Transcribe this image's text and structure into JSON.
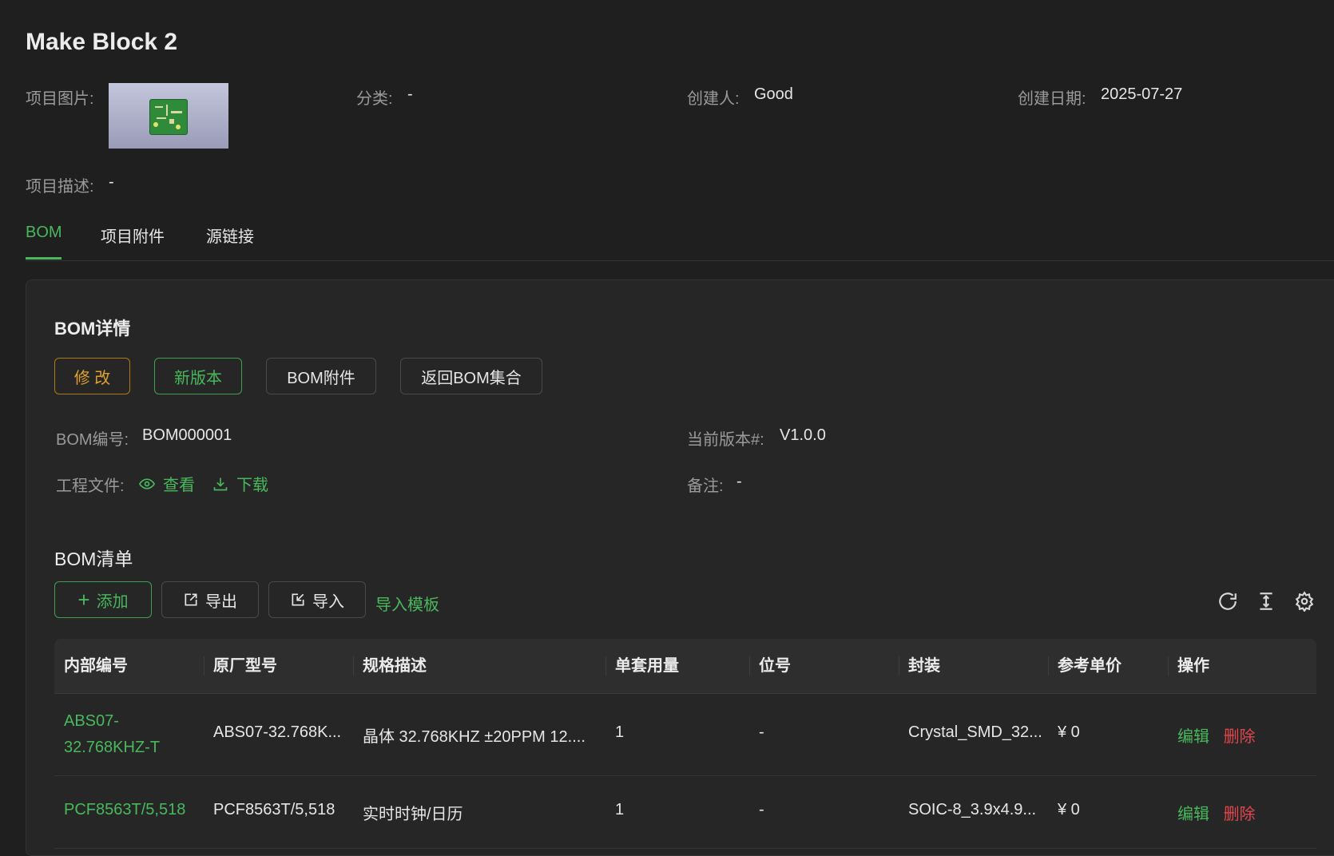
{
  "project": {
    "title": "Make Block 2",
    "image_label": "项目图片:",
    "category_label": "分类:",
    "category_value": "-",
    "creator_label": "创建人:",
    "creator_value": "Good",
    "created_label": "创建日期:",
    "created_value": "2025-07-27",
    "desc_label": "项目描述:",
    "desc_value": "-"
  },
  "tabs": [
    {
      "label": "BOM",
      "active": true
    },
    {
      "label": "项目附件",
      "active": false
    },
    {
      "label": "源链接",
      "active": false
    }
  ],
  "bom_detail": {
    "title": "BOM详情",
    "buttons": {
      "edit": "修 改",
      "new_version": "新版本",
      "attachments": "BOM附件",
      "back": "返回BOM集合"
    },
    "bom_no_label": "BOM编号:",
    "bom_no_value": "BOM000001",
    "version_label": "当前版本#:",
    "version_value": "V1.0.0",
    "eng_file_label": "工程文件:",
    "view_label": "查看",
    "download_label": "下载",
    "remark_label": "备注:",
    "remark_value": "-"
  },
  "bom_list": {
    "title": "BOM清单",
    "add_label": "添加",
    "export_label": "导出",
    "import_label": "导入",
    "template_label": "导入模板",
    "columns": [
      "内部编号",
      "原厂型号",
      "规格描述",
      "单套用量",
      "位号",
      "封装",
      "参考单价",
      "操作"
    ],
    "rows": [
      {
        "code": "ABS07-32.768KHZ-T",
        "mfr_part": "ABS07-32.768K...",
        "spec": "晶体 32.768KHZ ±20PPM 12....",
        "qty": "1",
        "designator": "-",
        "package": "Crystal_SMD_32...",
        "price": "¥ 0",
        "edit": "编辑",
        "delete": "删除"
      },
      {
        "code": "PCF8563T/5,518",
        "mfr_part": "PCF8563T/5,518",
        "spec": "实时时钟/日历",
        "qty": "1",
        "designator": "-",
        "package": "SOIC-8_3.9x4.9...",
        "price": "¥ 0",
        "edit": "编辑",
        "delete": "删除"
      }
    ]
  },
  "colors": {
    "accent_green": "#49b85c",
    "warning_orange": "#e0a12a",
    "danger_red": "#e0474c",
    "background": "#1f1f1f"
  },
  "icons": {
    "view": "eye-icon",
    "download": "download-icon",
    "add": "plus-icon",
    "export": "export-icon",
    "import": "import-icon",
    "refresh": "refresh-icon",
    "density": "column-height-icon",
    "settings": "gear-icon"
  }
}
